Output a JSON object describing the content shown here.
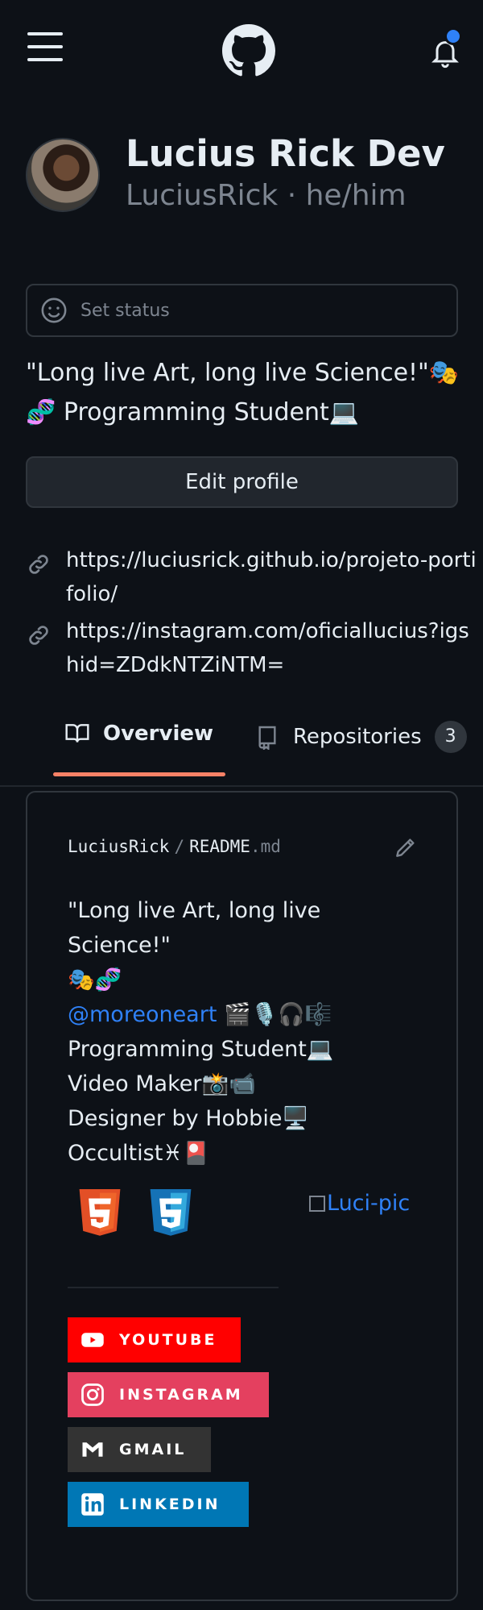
{
  "header": {
    "menu_icon": "hamburger-menu-icon",
    "logo_icon": "github-logo-icon",
    "notifications_icon": "bell-icon",
    "accent": "#2f81f7"
  },
  "profile": {
    "name": "Lucius Rick Dev",
    "login_line": "LuciusRick · he/him",
    "status_label": "Set status",
    "bio_lines": [
      "\"Long live Art, long live Science!\"🎭",
      "🧬 Programming Student💻"
    ],
    "edit_label": "Edit profile",
    "links": [
      "https://luciusrick.github.io/projeto-portifolio/",
      "https://instagram.com/oficiallucius?igshid=ZDdkNTZiNTM="
    ]
  },
  "tabs": {
    "overview": "Overview",
    "repositories": "Repositories",
    "repositories_count": "3",
    "underline_color": "#f78166"
  },
  "readme": {
    "path_user": "LuciusRick",
    "path_sep": "/",
    "path_file": "README",
    "path_ext": ".md",
    "lines": [
      "\"Long live Art, long live Science!\"",
      "🎭🧬",
      "@moreoneart",
      " 🎬🎙️🎧🎼",
      "Programming Student💻",
      "Video Maker📸📹",
      "Designer by Hobbie🖥️",
      "Occultist♓🎴"
    ],
    "pic_alt": "Luci-pic",
    "badges": [
      {
        "label": "YOUTUBE",
        "color": "#ff0000",
        "icon": "youtube-icon"
      },
      {
        "label": "INSTAGRAM",
        "color": "#e4405f",
        "icon": "instagram-icon"
      },
      {
        "label": "GMAIL",
        "color": "#333333",
        "icon": "gmail-icon"
      },
      {
        "label": "LINKEDIN",
        "color": "#0077b5",
        "icon": "linkedin-icon"
      }
    ]
  }
}
